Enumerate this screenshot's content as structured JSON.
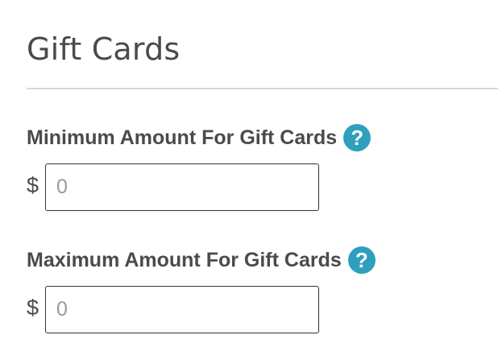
{
  "section": {
    "title": "Gift Cards"
  },
  "fields": [
    {
      "label": "Minimum Amount For Gift Cards",
      "help_icon": "?",
      "currency_symbol": "$",
      "placeholder": "0",
      "value": ""
    },
    {
      "label": "Maximum Amount For Gift Cards",
      "help_icon": "?",
      "currency_symbol": "$",
      "placeholder": "0",
      "value": ""
    }
  ],
  "colors": {
    "help_icon_bg": "#2e9fbd",
    "text": "#4b4b4b",
    "divider": "#d7d7d7",
    "input_border": "#333333"
  },
  "icons": {
    "help": "question-mark-circle-icon"
  }
}
